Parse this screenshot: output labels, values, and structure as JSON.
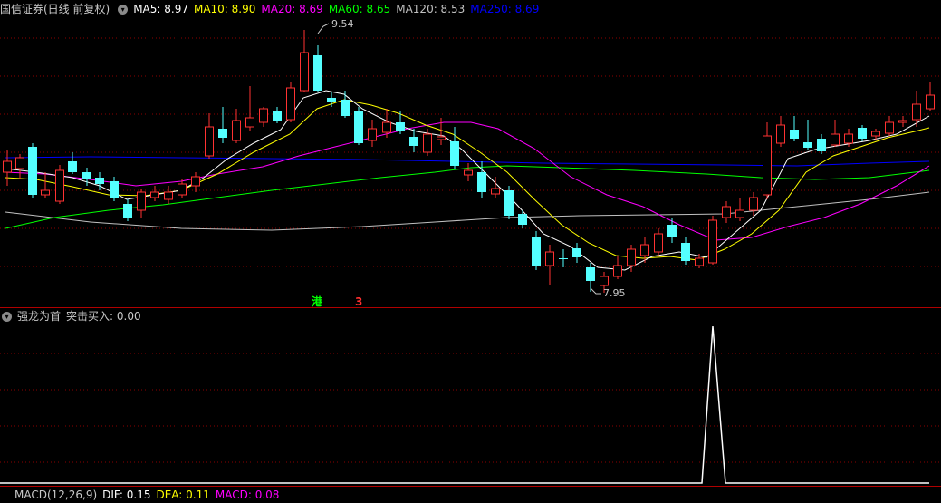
{
  "main_header": {
    "security_title": "国信证券(日线 前复权)",
    "ma": [
      {
        "label": "MA5: 8.97",
        "color": "#ffffff"
      },
      {
        "label": "MA10: 8.90",
        "color": "#ffff00"
      },
      {
        "label": "MA20: 8.69",
        "color": "#ff00ff"
      },
      {
        "label": "MA60: 8.65",
        "color": "#00ff00"
      },
      {
        "label": "MA120: 8.53",
        "color": "#c0c0c0"
      },
      {
        "label": "MA250: 8.69",
        "color": "#0000ff"
      }
    ]
  },
  "annotations": {
    "high_label": "9.54",
    "low_label": "7.95"
  },
  "markers": [
    {
      "text": "港",
      "color": "#00ff00"
    },
    {
      "text": "3",
      "color": "#ff3030"
    }
  ],
  "indicator1": {
    "title": "强龙为首",
    "value_label": "突击买入: 0.00"
  },
  "indicator2": {
    "title": "MACD(12,26,9)",
    "dif_label": "DIF: 0.15",
    "dea_label": "DEA: 0.11",
    "macd_label": "MACD: 0.08"
  },
  "colors": {
    "up": "#ff3232",
    "down": "#54ffff",
    "grid": "#8b0000",
    "separator": "#b00000",
    "signal": "#ffffff"
  },
  "icons": [
    "chevron-down-icon",
    "chevron-down-icon"
  ]
}
